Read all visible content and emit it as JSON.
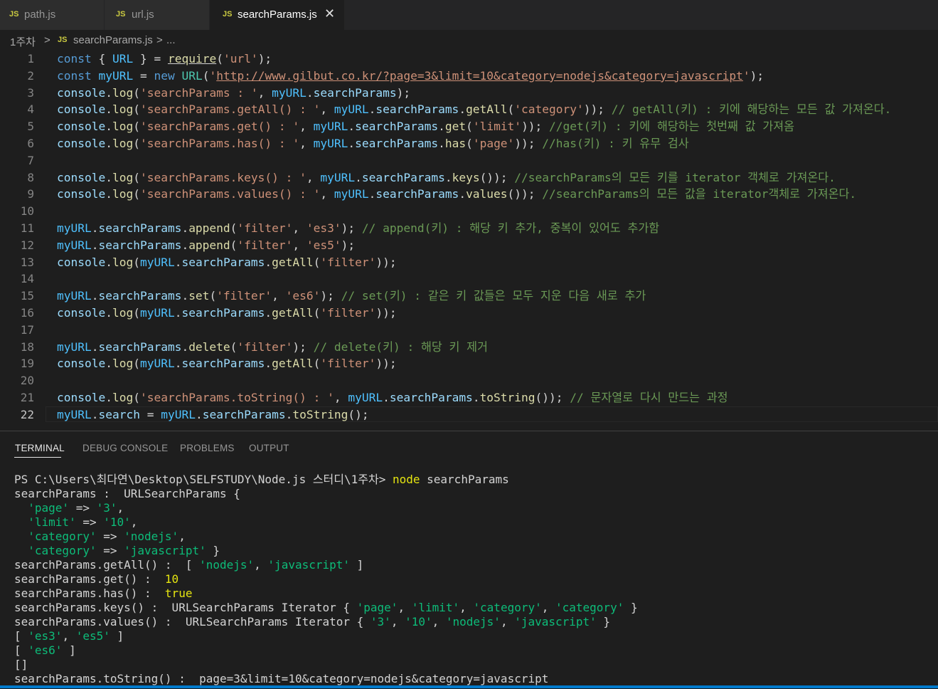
{
  "tabs": [
    {
      "icon": "JS",
      "label": "path.js"
    },
    {
      "icon": "JS",
      "label": "url.js"
    },
    {
      "icon": "JS",
      "label": "searchParams.js",
      "close": "✕"
    }
  ],
  "breadcrumb": {
    "folder": "1주차",
    "sep1": ">",
    "icon": "JS",
    "file": "searchParams.js",
    "sep2": ">",
    "more": "..."
  },
  "editor": {
    "line_numbers": [
      "1",
      "2",
      "3",
      "4",
      "5",
      "6",
      "7",
      "8",
      "9",
      "10",
      "11",
      "12",
      "13",
      "14",
      "15",
      "16",
      "17",
      "18",
      "19",
      "20",
      "21",
      "22"
    ],
    "lines": [
      [
        [
          "kw",
          "const"
        ],
        [
          "pl",
          " { "
        ],
        [
          "var",
          "URL"
        ],
        [
          "pl",
          " } = "
        ],
        [
          "req",
          "require"
        ],
        [
          "pl",
          "("
        ],
        [
          "str",
          "'url'"
        ],
        [
          "pl",
          ");"
        ]
      ],
      [
        [
          "kw",
          "const"
        ],
        [
          "pl",
          " "
        ],
        [
          "var",
          "myURL"
        ],
        [
          "pl",
          " = "
        ],
        [
          "kw",
          "new"
        ],
        [
          "pl",
          " "
        ],
        [
          "cls",
          "URL"
        ],
        [
          "pl",
          "("
        ],
        [
          "str",
          "'"
        ],
        [
          "url",
          "http://www.gilbut.co.kr/?page=3&limit=10&category=nodejs&category=javascript"
        ],
        [
          "str",
          "'"
        ],
        [
          "pl",
          ");"
        ]
      ],
      [
        [
          "prop",
          "console"
        ],
        [
          "pl",
          "."
        ],
        [
          "fn",
          "log"
        ],
        [
          "pl",
          "("
        ],
        [
          "str",
          "'searchParams : '"
        ],
        [
          "pl",
          ", "
        ],
        [
          "var",
          "myURL"
        ],
        [
          "pl",
          "."
        ],
        [
          "prop",
          "searchParams"
        ],
        [
          "pl",
          ");"
        ]
      ],
      [
        [
          "prop",
          "console"
        ],
        [
          "pl",
          "."
        ],
        [
          "fn",
          "log"
        ],
        [
          "pl",
          "("
        ],
        [
          "str",
          "'searchParams.getAll() : '"
        ],
        [
          "pl",
          ", "
        ],
        [
          "var",
          "myURL"
        ],
        [
          "pl",
          "."
        ],
        [
          "prop",
          "searchParams"
        ],
        [
          "pl",
          "."
        ],
        [
          "fn",
          "getAll"
        ],
        [
          "pl",
          "("
        ],
        [
          "str",
          "'category'"
        ],
        [
          "pl",
          "));"
        ],
        [
          "cmt",
          " // getAll(키) : 키에 해당하는 모든 값 가져온다."
        ]
      ],
      [
        [
          "prop",
          "console"
        ],
        [
          "pl",
          "."
        ],
        [
          "fn",
          "log"
        ],
        [
          "pl",
          "("
        ],
        [
          "str",
          "'searchParams.get() : '"
        ],
        [
          "pl",
          ", "
        ],
        [
          "var",
          "myURL"
        ],
        [
          "pl",
          "."
        ],
        [
          "prop",
          "searchParams"
        ],
        [
          "pl",
          "."
        ],
        [
          "fn",
          "get"
        ],
        [
          "pl",
          "("
        ],
        [
          "str",
          "'limit'"
        ],
        [
          "pl",
          "));"
        ],
        [
          "cmt",
          " //get(키) : 키에 해당하는 첫번째 값 가져옴"
        ]
      ],
      [
        [
          "prop",
          "console"
        ],
        [
          "pl",
          "."
        ],
        [
          "fn",
          "log"
        ],
        [
          "pl",
          "("
        ],
        [
          "str",
          "'searchParams.has() : '"
        ],
        [
          "pl",
          ", "
        ],
        [
          "var",
          "myURL"
        ],
        [
          "pl",
          "."
        ],
        [
          "prop",
          "searchParams"
        ],
        [
          "pl",
          "."
        ],
        [
          "fn",
          "has"
        ],
        [
          "pl",
          "("
        ],
        [
          "str",
          "'page'"
        ],
        [
          "pl",
          "));"
        ],
        [
          "cmt",
          " //has(키) : 키 유무 검사"
        ]
      ],
      [],
      [
        [
          "prop",
          "console"
        ],
        [
          "pl",
          "."
        ],
        [
          "fn",
          "log"
        ],
        [
          "pl",
          "("
        ],
        [
          "str",
          "'searchParams.keys() : '"
        ],
        [
          "pl",
          ", "
        ],
        [
          "var",
          "myURL"
        ],
        [
          "pl",
          "."
        ],
        [
          "prop",
          "searchParams"
        ],
        [
          "pl",
          "."
        ],
        [
          "fn",
          "keys"
        ],
        [
          "pl",
          "());"
        ],
        [
          "cmt",
          " //searchParams의 모든 키를 iterator 객체로 가져온다."
        ]
      ],
      [
        [
          "prop",
          "console"
        ],
        [
          "pl",
          "."
        ],
        [
          "fn",
          "log"
        ],
        [
          "pl",
          "("
        ],
        [
          "str",
          "'searchParams.values() : '"
        ],
        [
          "pl",
          ", "
        ],
        [
          "var",
          "myURL"
        ],
        [
          "pl",
          "."
        ],
        [
          "prop",
          "searchParams"
        ],
        [
          "pl",
          "."
        ],
        [
          "fn",
          "values"
        ],
        [
          "pl",
          "());"
        ],
        [
          "cmt",
          " //searchParams의 모든 값을 iterator객체로 가져온다."
        ]
      ],
      [],
      [
        [
          "var",
          "myURL"
        ],
        [
          "pl",
          "."
        ],
        [
          "prop",
          "searchParams"
        ],
        [
          "pl",
          "."
        ],
        [
          "fn",
          "append"
        ],
        [
          "pl",
          "("
        ],
        [
          "str",
          "'filter'"
        ],
        [
          "pl",
          ", "
        ],
        [
          "str",
          "'es3'"
        ],
        [
          "pl",
          ");"
        ],
        [
          "cmt",
          " // append(키) : 해당 키 추가, 중복이 있어도 추가함"
        ]
      ],
      [
        [
          "var",
          "myURL"
        ],
        [
          "pl",
          "."
        ],
        [
          "prop",
          "searchParams"
        ],
        [
          "pl",
          "."
        ],
        [
          "fn",
          "append"
        ],
        [
          "pl",
          "("
        ],
        [
          "str",
          "'filter'"
        ],
        [
          "pl",
          ", "
        ],
        [
          "str",
          "'es5'"
        ],
        [
          "pl",
          ");"
        ]
      ],
      [
        [
          "prop",
          "console"
        ],
        [
          "pl",
          "."
        ],
        [
          "fn",
          "log"
        ],
        [
          "pl",
          "("
        ],
        [
          "var",
          "myURL"
        ],
        [
          "pl",
          "."
        ],
        [
          "prop",
          "searchParams"
        ],
        [
          "pl",
          "."
        ],
        [
          "fn",
          "getAll"
        ],
        [
          "pl",
          "("
        ],
        [
          "str",
          "'filter'"
        ],
        [
          "pl",
          "));"
        ]
      ],
      [],
      [
        [
          "var",
          "myURL"
        ],
        [
          "pl",
          "."
        ],
        [
          "prop",
          "searchParams"
        ],
        [
          "pl",
          "."
        ],
        [
          "fn",
          "set"
        ],
        [
          "pl",
          "("
        ],
        [
          "str",
          "'filter'"
        ],
        [
          "pl",
          ", "
        ],
        [
          "str",
          "'es6'"
        ],
        [
          "pl",
          ");"
        ],
        [
          "cmt",
          " // set(키) : 같은 키 값들은 모두 지운 다음 새로 추가"
        ]
      ],
      [
        [
          "prop",
          "console"
        ],
        [
          "pl",
          "."
        ],
        [
          "fn",
          "log"
        ],
        [
          "pl",
          "("
        ],
        [
          "var",
          "myURL"
        ],
        [
          "pl",
          "."
        ],
        [
          "prop",
          "searchParams"
        ],
        [
          "pl",
          "."
        ],
        [
          "fn",
          "getAll"
        ],
        [
          "pl",
          "("
        ],
        [
          "str",
          "'filter'"
        ],
        [
          "pl",
          "));"
        ]
      ],
      [],
      [
        [
          "var",
          "myURL"
        ],
        [
          "pl",
          "."
        ],
        [
          "prop",
          "searchParams"
        ],
        [
          "pl",
          "."
        ],
        [
          "fn",
          "delete"
        ],
        [
          "pl",
          "("
        ],
        [
          "str",
          "'filter'"
        ],
        [
          "pl",
          ");"
        ],
        [
          "cmt",
          " // delete(키) : 해당 키 제거"
        ]
      ],
      [
        [
          "prop",
          "console"
        ],
        [
          "pl",
          "."
        ],
        [
          "fn",
          "log"
        ],
        [
          "pl",
          "("
        ],
        [
          "var",
          "myURL"
        ],
        [
          "pl",
          "."
        ],
        [
          "prop",
          "searchParams"
        ],
        [
          "pl",
          "."
        ],
        [
          "fn",
          "getAll"
        ],
        [
          "pl",
          "("
        ],
        [
          "str",
          "'filter'"
        ],
        [
          "pl",
          "));"
        ]
      ],
      [],
      [
        [
          "prop",
          "console"
        ],
        [
          "pl",
          "."
        ],
        [
          "fn",
          "log"
        ],
        [
          "pl",
          "("
        ],
        [
          "str",
          "'searchParams.toString() : '"
        ],
        [
          "pl",
          ", "
        ],
        [
          "var",
          "myURL"
        ],
        [
          "pl",
          "."
        ],
        [
          "prop",
          "searchParams"
        ],
        [
          "pl",
          "."
        ],
        [
          "fn",
          "toString"
        ],
        [
          "pl",
          "());"
        ],
        [
          "cmt",
          " // 문자열로 다시 만드는 과정"
        ]
      ],
      [
        [
          "var",
          "myURL"
        ],
        [
          "pl",
          "."
        ],
        [
          "prop",
          "search"
        ],
        [
          "pl",
          " = "
        ],
        [
          "var",
          "myURL"
        ],
        [
          "pl",
          "."
        ],
        [
          "prop",
          "searchParams"
        ],
        [
          "pl",
          "."
        ],
        [
          "fn",
          "toString"
        ],
        [
          "pl",
          "();"
        ]
      ]
    ]
  },
  "panel_tabs": [
    "TERMINAL",
    "DEBUG CONSOLE",
    "PROBLEMS",
    "OUTPUT"
  ],
  "terminal": {
    "lines": [
      [
        [
          "pl",
          "PS C:\\Users\\최다연\\Desktop\\SELFSTUDY\\Node.js 스터디\\1주차> "
        ],
        [
          "ty",
          "node"
        ],
        [
          "pl",
          " searchParams"
        ]
      ],
      [
        [
          "pl",
          "searchParams :  URLSearchParams {"
        ]
      ],
      [
        [
          "pl",
          "  "
        ],
        [
          "tg",
          "'page'"
        ],
        [
          "pl",
          " => "
        ],
        [
          "tg",
          "'3'"
        ],
        [
          "pl",
          ","
        ]
      ],
      [
        [
          "pl",
          "  "
        ],
        [
          "tg",
          "'limit'"
        ],
        [
          "pl",
          " => "
        ],
        [
          "tg",
          "'10'"
        ],
        [
          "pl",
          ","
        ]
      ],
      [
        [
          "pl",
          "  "
        ],
        [
          "tg",
          "'category'"
        ],
        [
          "pl",
          " => "
        ],
        [
          "tg",
          "'nodejs'"
        ],
        [
          "pl",
          ","
        ]
      ],
      [
        [
          "pl",
          "  "
        ],
        [
          "tg",
          "'category'"
        ],
        [
          "pl",
          " => "
        ],
        [
          "tg",
          "'javascript'"
        ],
        [
          "pl",
          " }"
        ]
      ],
      [
        [
          "pl",
          "searchParams.getAll() :  [ "
        ],
        [
          "tg",
          "'nodejs'"
        ],
        [
          "pl",
          ", "
        ],
        [
          "tg",
          "'javascript'"
        ],
        [
          "pl",
          " ]"
        ]
      ],
      [
        [
          "pl",
          "searchParams.get() :  "
        ],
        [
          "ty",
          "10"
        ]
      ],
      [
        [
          "pl",
          "searchParams.has() :  "
        ],
        [
          "ty",
          "true"
        ]
      ],
      [
        [
          "pl",
          "searchParams.keys() :  URLSearchParams Iterator { "
        ],
        [
          "tg",
          "'page'"
        ],
        [
          "pl",
          ", "
        ],
        [
          "tg",
          "'limit'"
        ],
        [
          "pl",
          ", "
        ],
        [
          "tg",
          "'category'"
        ],
        [
          "pl",
          ", "
        ],
        [
          "tg",
          "'category'"
        ],
        [
          "pl",
          " }"
        ]
      ],
      [
        [
          "pl",
          "searchParams.values() :  URLSearchParams Iterator { "
        ],
        [
          "tg",
          "'3'"
        ],
        [
          "pl",
          ", "
        ],
        [
          "tg",
          "'10'"
        ],
        [
          "pl",
          ", "
        ],
        [
          "tg",
          "'nodejs'"
        ],
        [
          "pl",
          ", "
        ],
        [
          "tg",
          "'javascript'"
        ],
        [
          "pl",
          " }"
        ]
      ],
      [
        [
          "pl",
          "[ "
        ],
        [
          "tg",
          "'es3'"
        ],
        [
          "pl",
          ", "
        ],
        [
          "tg",
          "'es5'"
        ],
        [
          "pl",
          " ]"
        ]
      ],
      [
        [
          "pl",
          "[ "
        ],
        [
          "tg",
          "'es6'"
        ],
        [
          "pl",
          " ]"
        ]
      ],
      [
        [
          "pl",
          "[]"
        ]
      ],
      [
        [
          "pl",
          "searchParams.toString() :  page=3&limit=10&category=nodejs&category=javascript"
        ]
      ]
    ]
  }
}
